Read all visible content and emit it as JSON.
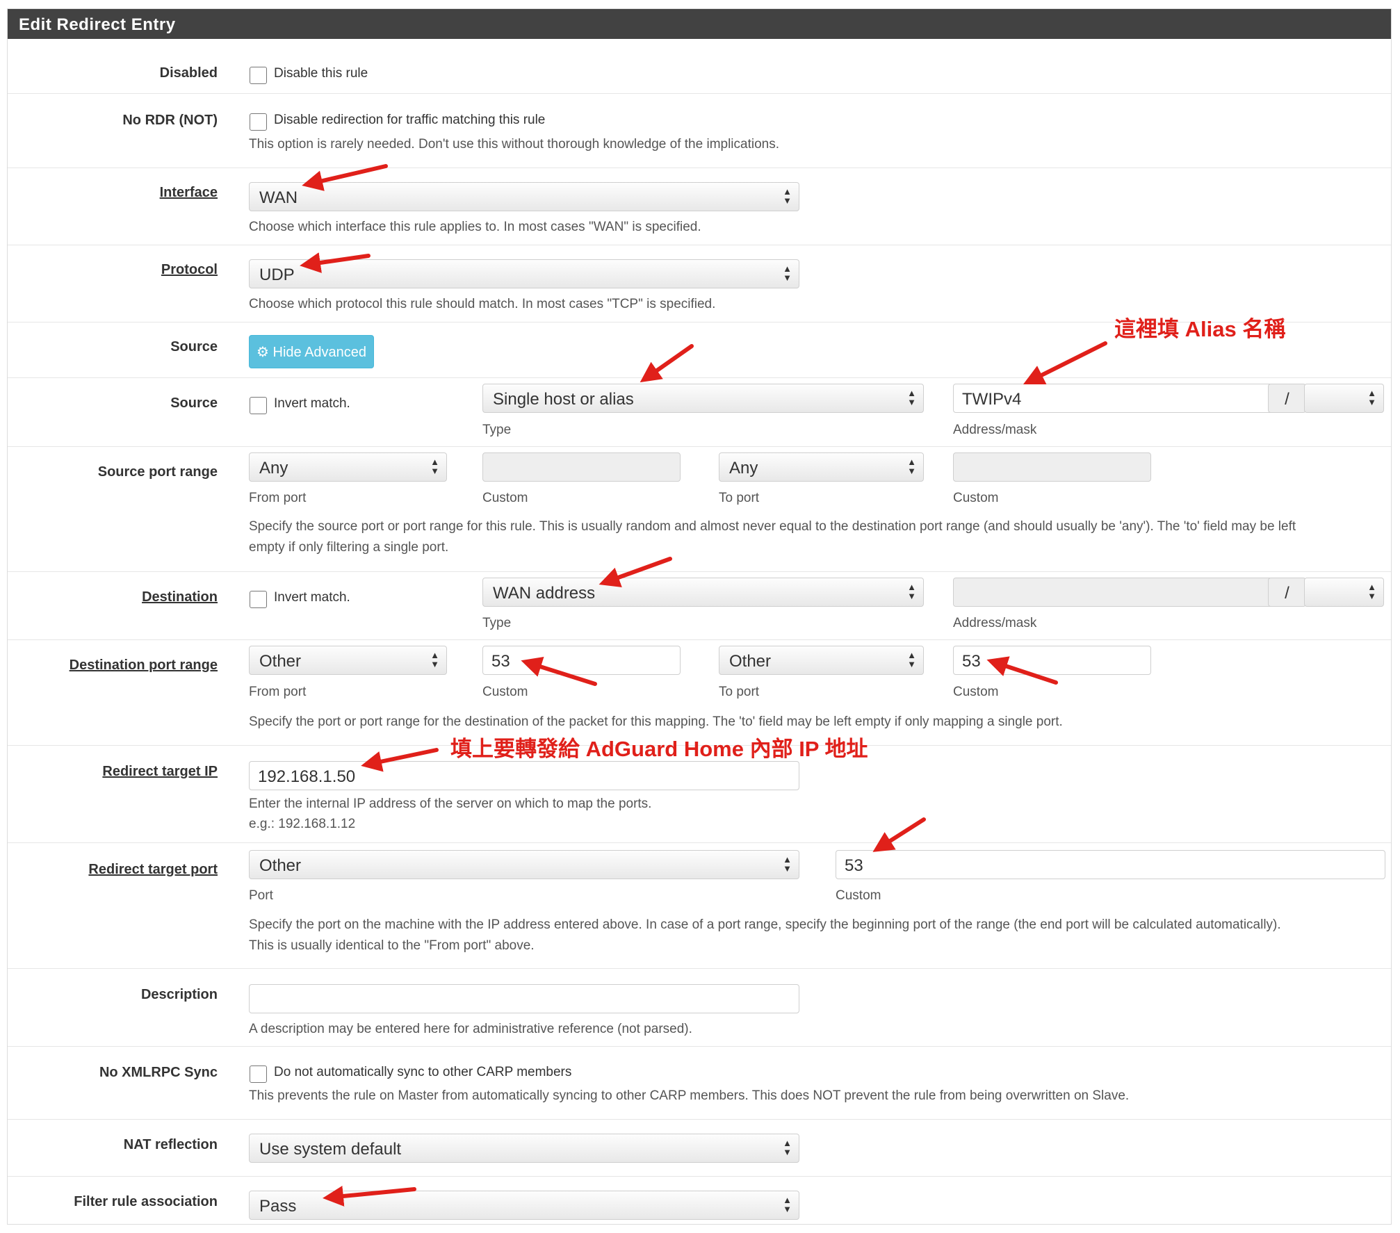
{
  "panel": {
    "title": "Edit Redirect Entry"
  },
  "disabled": {
    "label": "Disabled",
    "checkbox_text": "Disable this rule"
  },
  "nordr": {
    "label": "No RDR (NOT)",
    "checkbox_text": "Disable redirection for traffic matching this rule",
    "help": "This option is rarely needed. Don't use this without thorough knowledge of the implications."
  },
  "interface": {
    "label": "Interface",
    "value": "WAN",
    "help": "Choose which interface this rule applies to. In most cases \"WAN\" is specified."
  },
  "protocol": {
    "label": "Protocol",
    "value": "UDP",
    "help": "Choose which protocol this rule should match. In most cases \"TCP\" is specified."
  },
  "source_adv": {
    "label": "Source",
    "button": "Hide Advanced"
  },
  "source": {
    "label": "Source",
    "invert_text": "Invert match.",
    "type_value": "Single host or alias",
    "type_label": "Type",
    "address_value": "TWIPv4",
    "slash": "/",
    "address_label": "Address/mask"
  },
  "source_port": {
    "label": "Source port range",
    "from_value": "Any",
    "from_label": "From port",
    "custom1_label": "Custom",
    "to_value": "Any",
    "to_label": "To port",
    "custom2_label": "Custom",
    "help1": "Specify the source port or port range for this rule. This is usually random and almost never equal to the destination port range (and should usually be 'any'). The 'to' field may be left",
    "help2": "empty if only filtering a single port."
  },
  "destination": {
    "label": "Destination",
    "invert_text": "Invert match.",
    "type_value": "WAN address",
    "type_label": "Type",
    "slash": "/",
    "address_label": "Address/mask"
  },
  "dest_port": {
    "label": "Destination port range",
    "from_value": "Other",
    "from_label": "From port",
    "custom1_value": "53",
    "custom1_label": "Custom",
    "to_value": "Other",
    "to_label": "To port",
    "custom2_value": "53",
    "custom2_label": "Custom",
    "help": "Specify the port or port range for the destination of the packet for this mapping. The 'to' field may be left empty if only mapping a single port."
  },
  "target_ip": {
    "label": "Redirect target IP",
    "value": "192.168.1.50",
    "help1": "Enter the internal IP address of the server on which to map the ports.",
    "help2": "e.g.: 192.168.1.12"
  },
  "target_port": {
    "label": "Redirect target port",
    "port_value": "Other",
    "port_label": "Port",
    "custom_value": "53",
    "custom_label": "Custom",
    "help1": "Specify the port on the machine with the IP address entered above. In case of a port range, specify the beginning port of the range (the end port will be calculated automatically).",
    "help2": "This is usually identical to the \"From port\" above."
  },
  "description": {
    "label": "Description",
    "help": "A description may be entered here for administrative reference (not parsed)."
  },
  "xmlrpc": {
    "label": "No XMLRPC Sync",
    "checkbox_text": "Do not automatically sync to other CARP members",
    "help": "This prevents the rule on Master from automatically syncing to other CARP members. This does NOT prevent the rule from being overwritten on Slave."
  },
  "nat_reflection": {
    "label": "NAT reflection",
    "value": "Use system default"
  },
  "filter_assoc": {
    "label": "Filter rule association",
    "value": "Pass"
  },
  "annotations": {
    "alias_note": "這裡填 Alias 名稱",
    "ip_note": "填上要轉發給 AdGuard Home 內部 IP 地址",
    "arrow_color": "#e0201a"
  },
  "icons": {
    "gear": "gear-icon",
    "select_arrows": "updown-arrows-icon"
  }
}
